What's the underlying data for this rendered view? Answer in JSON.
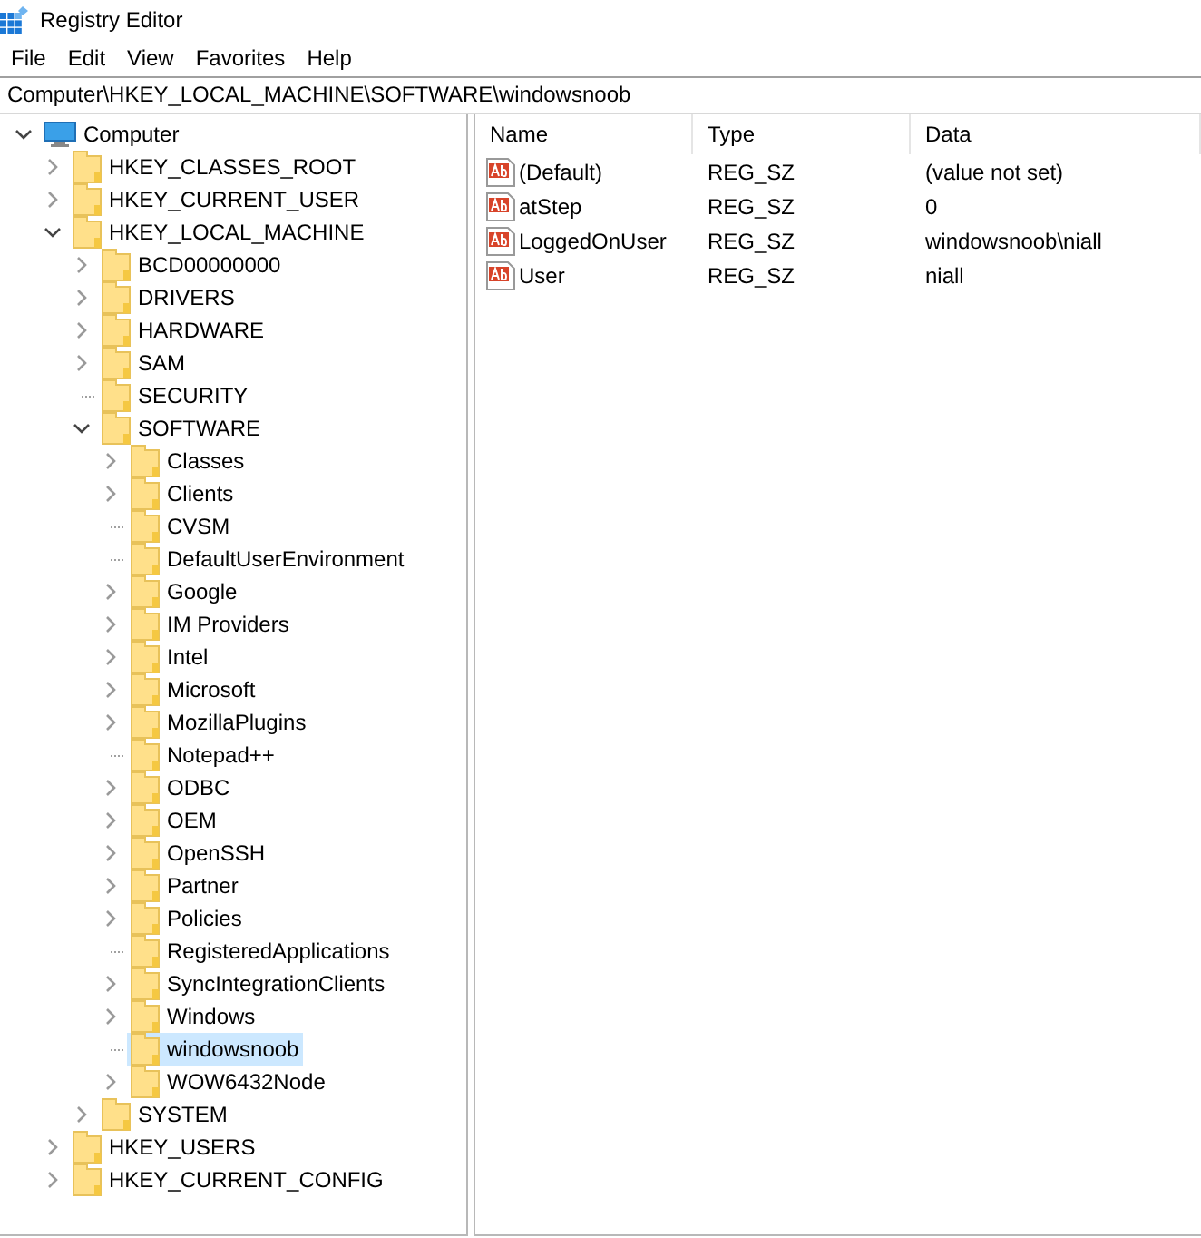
{
  "window": {
    "title": "Registry Editor"
  },
  "menu": [
    "File",
    "Edit",
    "View",
    "Favorites",
    "Help"
  ],
  "address": "Computer\\HKEY_LOCAL_MACHINE\\SOFTWARE\\windowsnoob",
  "tree": {
    "label": "Computer",
    "kind": "computer",
    "expanded": true,
    "has_subkeys": true,
    "selected": false,
    "children": [
      {
        "label": "HKEY_CLASSES_ROOT",
        "expanded": false,
        "has_subkeys": true,
        "selected": false
      },
      {
        "label": "HKEY_CURRENT_USER",
        "expanded": false,
        "has_subkeys": true,
        "selected": false
      },
      {
        "label": "HKEY_LOCAL_MACHINE",
        "expanded": true,
        "has_subkeys": true,
        "selected": false,
        "children": [
          {
            "label": "BCD00000000",
            "expanded": false,
            "has_subkeys": true,
            "selected": false
          },
          {
            "label": "DRIVERS",
            "expanded": false,
            "has_subkeys": true,
            "selected": false
          },
          {
            "label": "HARDWARE",
            "expanded": false,
            "has_subkeys": true,
            "selected": false
          },
          {
            "label": "SAM",
            "expanded": false,
            "has_subkeys": true,
            "selected": false
          },
          {
            "label": "SECURITY",
            "expanded": false,
            "has_subkeys": false,
            "selected": false
          },
          {
            "label": "SOFTWARE",
            "expanded": true,
            "has_subkeys": true,
            "selected": false,
            "children": [
              {
                "label": "Classes",
                "expanded": false,
                "has_subkeys": true,
                "selected": false
              },
              {
                "label": "Clients",
                "expanded": false,
                "has_subkeys": true,
                "selected": false
              },
              {
                "label": "CVSM",
                "expanded": false,
                "has_subkeys": false,
                "selected": false
              },
              {
                "label": "DefaultUserEnvironment",
                "expanded": false,
                "has_subkeys": false,
                "selected": false
              },
              {
                "label": "Google",
                "expanded": false,
                "has_subkeys": true,
                "selected": false
              },
              {
                "label": "IM Providers",
                "expanded": false,
                "has_subkeys": true,
                "selected": false
              },
              {
                "label": "Intel",
                "expanded": false,
                "has_subkeys": true,
                "selected": false
              },
              {
                "label": "Microsoft",
                "expanded": false,
                "has_subkeys": true,
                "selected": false
              },
              {
                "label": "MozillaPlugins",
                "expanded": false,
                "has_subkeys": true,
                "selected": false
              },
              {
                "label": "Notepad++",
                "expanded": false,
                "has_subkeys": false,
                "selected": false
              },
              {
                "label": "ODBC",
                "expanded": false,
                "has_subkeys": true,
                "selected": false
              },
              {
                "label": "OEM",
                "expanded": false,
                "has_subkeys": true,
                "selected": false
              },
              {
                "label": "OpenSSH",
                "expanded": false,
                "has_subkeys": true,
                "selected": false
              },
              {
                "label": "Partner",
                "expanded": false,
                "has_subkeys": true,
                "selected": false
              },
              {
                "label": "Policies",
                "expanded": false,
                "has_subkeys": true,
                "selected": false
              },
              {
                "label": "RegisteredApplications",
                "expanded": false,
                "has_subkeys": false,
                "selected": false
              },
              {
                "label": "SyncIntegrationClients",
                "expanded": false,
                "has_subkeys": true,
                "selected": false
              },
              {
                "label": "Windows",
                "expanded": false,
                "has_subkeys": true,
                "selected": false
              },
              {
                "label": "windowsnoob",
                "expanded": false,
                "has_subkeys": false,
                "selected": true
              },
              {
                "label": "WOW6432Node",
                "expanded": false,
                "has_subkeys": true,
                "selected": false
              }
            ]
          },
          {
            "label": "SYSTEM",
            "expanded": false,
            "has_subkeys": true,
            "selected": false
          }
        ]
      },
      {
        "label": "HKEY_USERS",
        "expanded": false,
        "has_subkeys": true,
        "selected": false
      },
      {
        "label": "HKEY_CURRENT_CONFIG",
        "expanded": false,
        "has_subkeys": true,
        "selected": false
      }
    ]
  },
  "values": {
    "columns": [
      "Name",
      "Type",
      "Data"
    ],
    "rows": [
      {
        "name": "(Default)",
        "type": "REG_SZ",
        "data": "(value not set)"
      },
      {
        "name": "atStep",
        "type": "REG_SZ",
        "data": "0"
      },
      {
        "name": "LoggedOnUser",
        "type": "REG_SZ",
        "data": "windowsnoob\\niall"
      },
      {
        "name": "User",
        "type": "REG_SZ",
        "data": "niall"
      }
    ]
  }
}
